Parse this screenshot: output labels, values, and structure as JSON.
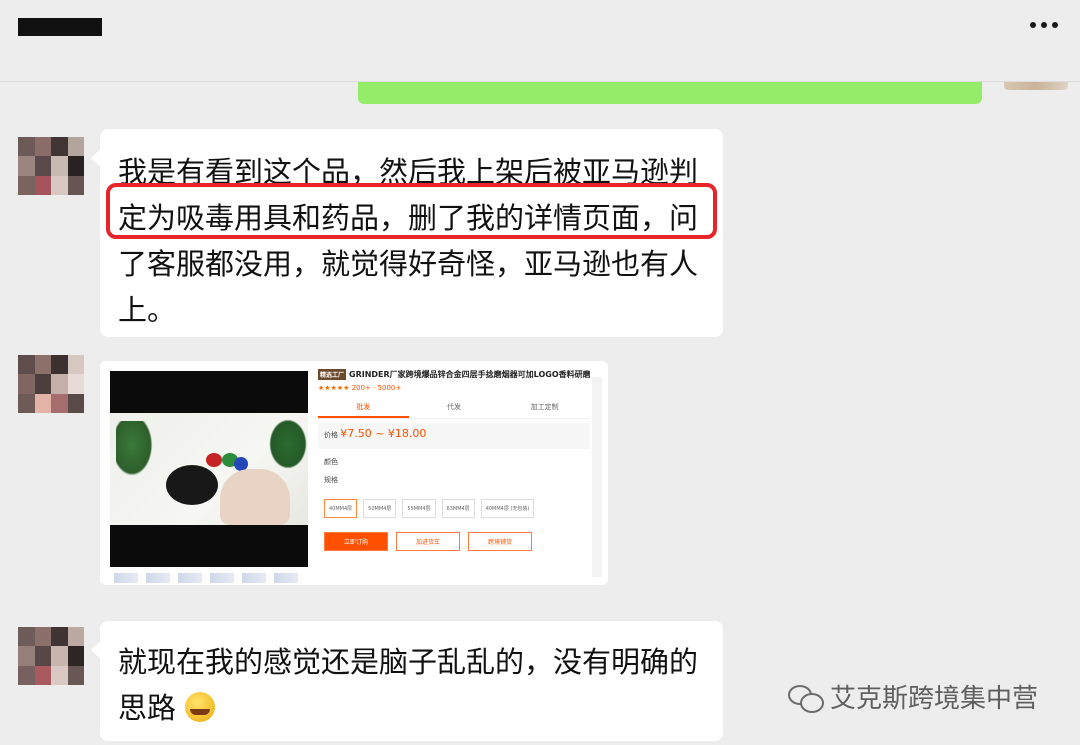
{
  "header": {
    "more_icon": "more-dots-icon"
  },
  "messages": [
    {
      "id": "m1",
      "type": "text",
      "text": "我是有看到这个品，然后我上架后被亚马逊判\n定为吸毒用具和药品，删了我的详情页面，问\n了客服都没用，就觉得好奇怪，亚马逊也有人\n上。"
    },
    {
      "id": "m2",
      "type": "image",
      "image": {
        "tag": "精选工厂",
        "title": "GRINDER厂家跨境爆品锌合金四层手捻磨烟器可加LOGO香料研磨器",
        "rating_text": "★★★★★",
        "stat1": "200+",
        "stat2": "5000+",
        "tabs": [
          "批发",
          "代发",
          "加工定制"
        ],
        "price_label": "价格",
        "price": "¥7.50 ~ ¥18.00",
        "row_label_1": "颜色",
        "row_label_2": "规格",
        "options": [
          "40MM4层",
          "50MM4层",
          "55MM4层",
          "63MM4层",
          "40MM4层 (无包装)"
        ],
        "buttons": [
          "立即订购",
          "加进货车",
          "跨境铺货"
        ]
      }
    },
    {
      "id": "m3",
      "type": "text",
      "text": "就现在我的感觉还是脑子乱乱的，没有明确的\n思路",
      "emoji": "crying-laughing-emoji"
    }
  ],
  "watermark": {
    "text": "艾克斯跨境集中营",
    "icon": "wechat-icon"
  },
  "colors": {
    "background": "#ededed",
    "bubble_self": "#95ec69",
    "bubble_other": "#ffffff",
    "highlight": "#e8232a"
  }
}
